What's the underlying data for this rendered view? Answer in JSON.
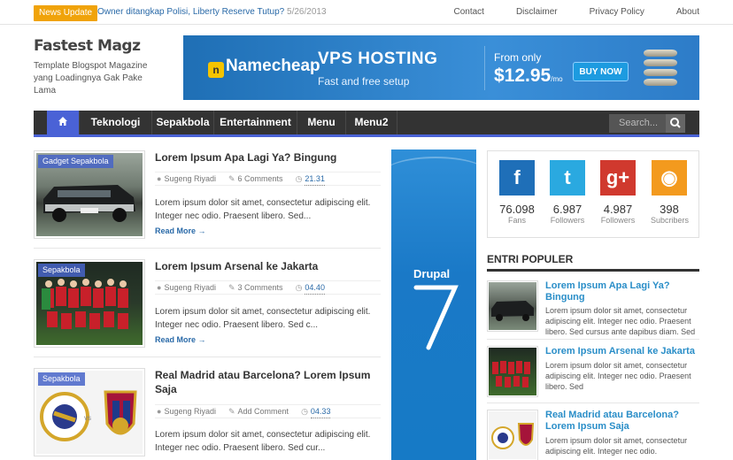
{
  "topbar": {
    "badge": "News Update",
    "headline": "Owner ditangkap Polisi, Liberty Reserve Tutup?",
    "headline_date": "5/26/2013",
    "links": [
      "Contact",
      "Disclaimer",
      "Privacy Policy",
      "About"
    ]
  },
  "site": {
    "title": "Fastest Magz",
    "description": "Template Blogspot Magazine yang Loadingnya Gak Pake Lama"
  },
  "banner": {
    "logo": "Namecheap",
    "headline": "VPS HOSTING",
    "subline": "Fast and free setup",
    "from": "From only",
    "price": "$12.95",
    "period": "/mo",
    "cta": "BUY NOW"
  },
  "nav": {
    "items": [
      "Teknologi",
      "Sepakbola",
      "Entertainment",
      "Menu",
      "Menu2"
    ],
    "search_placeholder": "Search..."
  },
  "posts": [
    {
      "tags": "Gadget    Sepakbola",
      "title": "Lorem Ipsum Apa Lagi Ya? Bingung",
      "author": "Sugeng Riyadi",
      "comments": "6 Comments",
      "time": "21.31",
      "excerpt": "Lorem ipsum dolor sit amet, consectetur adipiscing elit. Integer nec odio. Praesent libero. Sed...",
      "more": "Read More →"
    },
    {
      "tags": "Sepakbola",
      "title": "Lorem Ipsum Arsenal ke Jakarta",
      "author": "Sugeng Riyadi",
      "comments": "3 Comments",
      "time": "04.40",
      "excerpt": "Lorem ipsum dolor sit amet, consectetur adipiscing elit. Integer nec odio. Praesent libero. Sed c...",
      "more": "Read More →"
    },
    {
      "tags": "Sepakbola",
      "title": "Real Madrid atau Barcelona? Lorem Ipsum Saja",
      "author": "Sugeng Riyadi",
      "comments": "Add Comment",
      "time": "04.33",
      "excerpt": "Lorem ipsum dolor sit amet, consectetur adipiscing elit. Integer nec odio. Praesent libero. Sed cur..."
    }
  ],
  "ad": {
    "brand": "Drupal",
    "version": "7"
  },
  "social": [
    {
      "icon": "facebook-icon",
      "glyph": "f",
      "count": "76.098",
      "label": "Fans",
      "color": "#1f6fb8"
    },
    {
      "icon": "twitter-icon",
      "glyph": "t",
      "count": "6.987",
      "label": "Followers",
      "color": "#2aa9e0"
    },
    {
      "icon": "googleplus-icon",
      "glyph": "g+",
      "count": "4.987",
      "label": "Followers",
      "color": "#d0392e"
    },
    {
      "icon": "rss-icon",
      "glyph": "◉",
      "count": "398",
      "label": "Subcribers",
      "color": "#f39a1e"
    }
  ],
  "popular": {
    "heading": "ENTRI POPULER",
    "items": [
      {
        "title": "Lorem Ipsum Apa Lagi Ya? Bingung",
        "excerpt": "Lorem ipsum dolor sit amet, consectetur adipiscing elit. Integer nec odio. Praesent libero. Sed cursus ante dapibus diam. Sed"
      },
      {
        "title": "Lorem Ipsum Arsenal ke Jakarta",
        "excerpt": "Lorem ipsum dolor sit amet, consectetur adipiscing elit. Integer nec odio. Praesent libero. Sed"
      },
      {
        "title": "Real Madrid atau Barcelona? Lorem Ipsum Saja",
        "excerpt": "Lorem ipsum dolor sit amet, consectetur adipiscing elit. Integer nec odio."
      }
    ]
  },
  "colors": {
    "accent": "#4a62d6",
    "badge": "#f0a30a",
    "link": "#2a6aa8"
  }
}
